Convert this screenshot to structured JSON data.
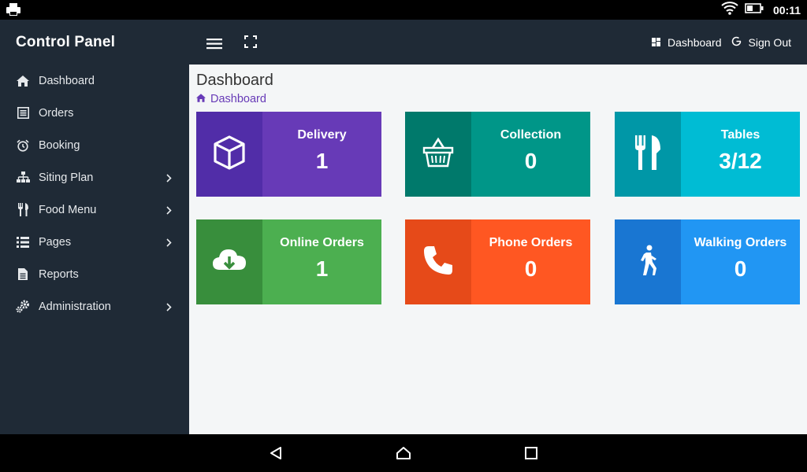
{
  "statusbar": {
    "time": "00:11"
  },
  "sidebar": {
    "brand": "Control Panel",
    "items": [
      {
        "label": "Dashboard",
        "icon": "home-icon"
      },
      {
        "label": "Orders",
        "icon": "list-icon"
      },
      {
        "label": "Booking",
        "icon": "alarm-clock-icon"
      },
      {
        "label": "Siting Plan",
        "icon": "sitemap-icon",
        "submenu": true
      },
      {
        "label": "Food Menu",
        "icon": "cutlery-icon",
        "submenu": true
      },
      {
        "label": "Pages",
        "icon": "pages-list-icon",
        "submenu": true
      },
      {
        "label": "Reports",
        "icon": "file-icon"
      },
      {
        "label": "Administration",
        "icon": "cogs-icon",
        "submenu": true
      }
    ]
  },
  "topbar": {
    "dashboard_link": "Dashboard",
    "signout_link": "Sign Out"
  },
  "main": {
    "title": "Dashboard",
    "breadcrumb": "Dashboard"
  },
  "cards": [
    {
      "label": "Delivery",
      "value": "1",
      "icon": "box-icon",
      "color": "#673ab7",
      "dark": "#512da8"
    },
    {
      "label": "Collection",
      "value": "0",
      "icon": "basket-icon",
      "color": "#009688",
      "dark": "#00796b"
    },
    {
      "label": "Tables",
      "value": "3/12",
      "icon": "cutlery-icon",
      "color": "#00bcd4",
      "dark": "#0097a7"
    },
    {
      "label": "Online Orders",
      "value": "1",
      "icon": "cloud-download-icon",
      "color": "#4caf50",
      "dark": "#388e3c"
    },
    {
      "label": "Phone Orders",
      "value": "0",
      "icon": "phone-icon",
      "color": "#ff5722",
      "dark": "#e64a19"
    },
    {
      "label": "Walking Orders",
      "value": "0",
      "icon": "walking-icon",
      "color": "#2196f3",
      "dark": "#1976d2"
    }
  ]
}
